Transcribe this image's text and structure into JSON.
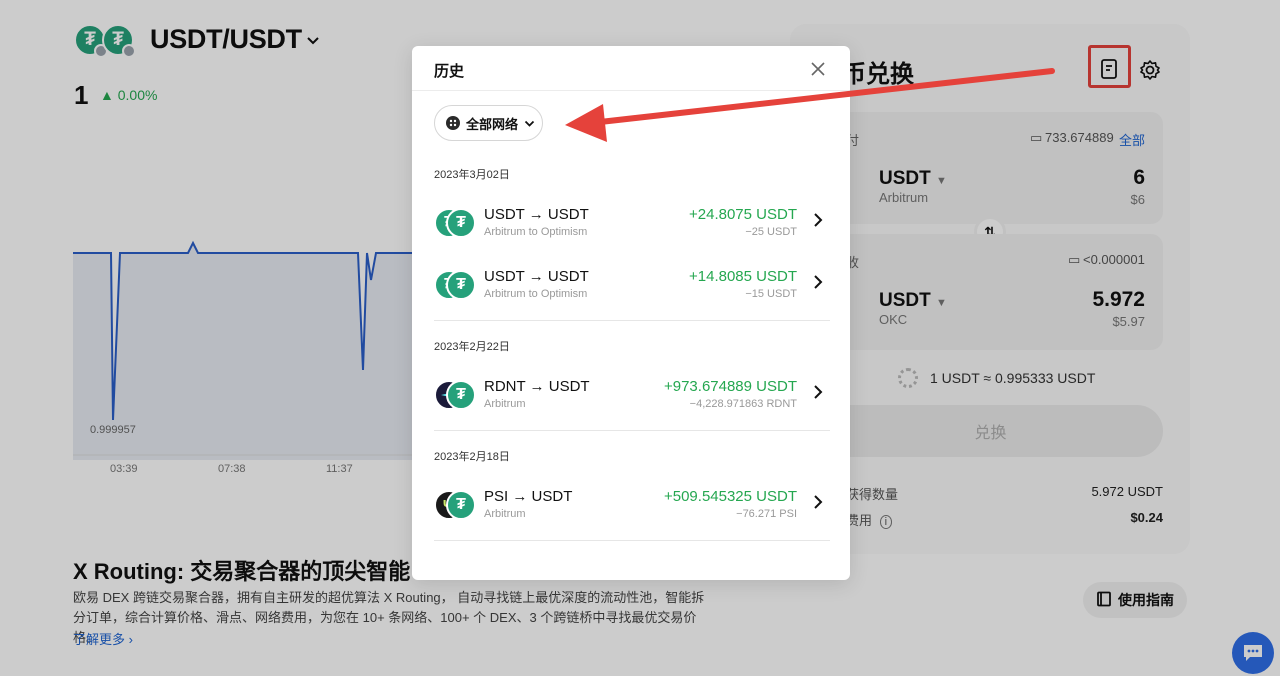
{
  "background": {
    "pair": "USDT/USDT",
    "price": "1",
    "change": "0.00%",
    "chart": {
      "min_label": "0.999957",
      "x_ticks": [
        "03:39",
        "07:38",
        "11:37"
      ]
    },
    "routing": {
      "title": "X Routing: 交易聚合器的顶尖智能",
      "desc": "欧易 DEX 跨链交易聚合器，拥有自主研发的超优算法 X Routing， 自动寻找链上最优深度的流动性池，智能拆分订单，综合计算价格、滑点、网络费用，为您在 10+ 条网络、100+ 个 DEX、3 个跨链桥中寻找最优交易价格。",
      "more": "了解更多"
    },
    "swap": {
      "title": "币兑换",
      "pay_label": "付",
      "pay_balance": "733.674889",
      "pay_all": "全部",
      "pay_symbol": "USDT",
      "pay_network": "Arbitrum",
      "pay_amount": "6",
      "pay_usd": "$6",
      "recv_label": "收",
      "recv_balance": "<0.000001",
      "recv_symbol": "USDT",
      "recv_network": "OKC",
      "recv_amount": "5.972",
      "recv_usd": "$5.97",
      "rate": "1 USDT ≈ 0.995333 USDT",
      "swap_button": "兑换",
      "min_recv_label": "获得数量",
      "min_recv_value": "5.972 USDT",
      "fee_label": "费用",
      "fee_value": "$0.24"
    },
    "guide_button": "使用指南"
  },
  "modal": {
    "title": "历史",
    "network_filter": "全部网络",
    "groups": [
      {
        "date": "2023年3月02日",
        "items": [
          {
            "from": "USDT",
            "to": "USDT",
            "route": "Arbitrum to Optimism",
            "received": "+24.8075 USDT",
            "spent": "−25 USDT"
          },
          {
            "from": "USDT",
            "to": "USDT",
            "route": "Arbitrum to Optimism",
            "received": "+14.8085 USDT",
            "spent": "−15 USDT"
          }
        ]
      },
      {
        "date": "2023年2月22日",
        "items": [
          {
            "from": "RDNT",
            "to": "USDT",
            "route": "Arbitrum",
            "received": "+973.674889 USDT",
            "spent": "−4,228.971863 RDNT"
          }
        ]
      },
      {
        "date": "2023年2月18日",
        "items": [
          {
            "from": "PSI",
            "to": "USDT",
            "route": "Arbitrum",
            "received": "+509.545325 USDT",
            "spent": "−76.271 PSI"
          }
        ]
      }
    ]
  },
  "colors": {
    "positive": "#25a750",
    "link": "#1e64d2",
    "annotation": "#e5423b",
    "usdt": "#26a17b"
  }
}
